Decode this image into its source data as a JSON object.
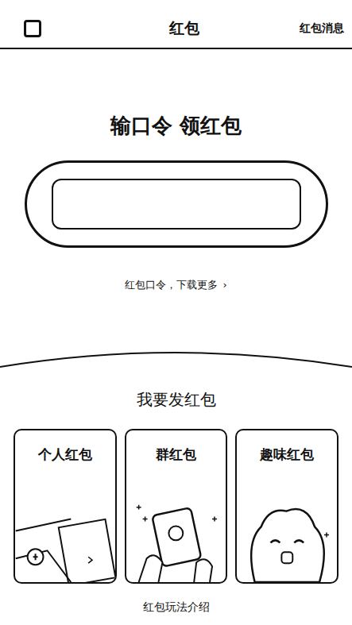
{
  "nav": {
    "title": "红包",
    "action": "红包消息"
  },
  "redeem": {
    "title": "输口令 领红包",
    "input_value": "",
    "hint": "红包口令，下载更多",
    "hint_arrow": "›"
  },
  "send": {
    "title": "我要发红包",
    "cards": [
      {
        "title": "个人红包"
      },
      {
        "title": "群红包"
      },
      {
        "title": "趣味红包"
      }
    ]
  },
  "footer": {
    "link": "红包玩法介绍"
  }
}
